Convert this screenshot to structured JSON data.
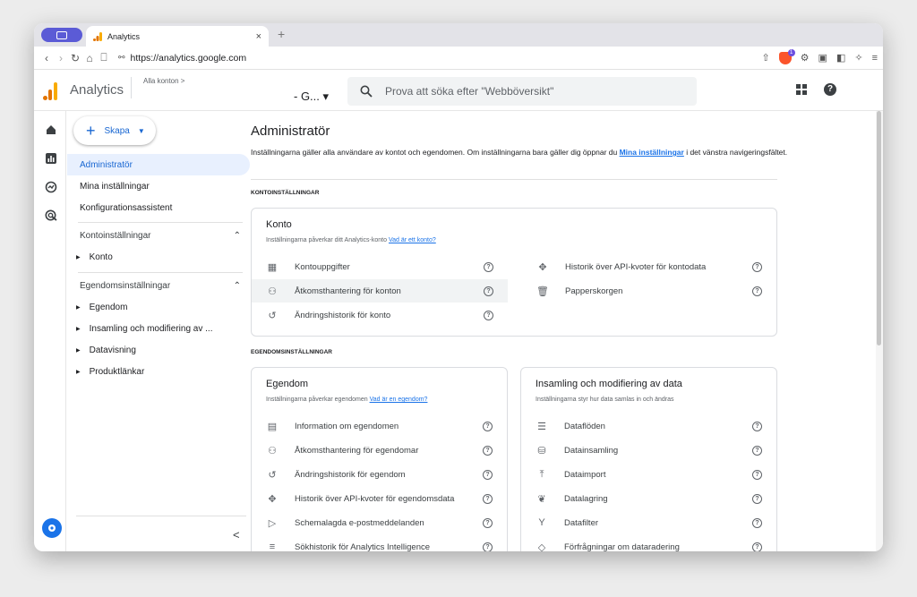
{
  "browser": {
    "tab_title": "Analytics",
    "tab_close": "×",
    "new_tab": "+",
    "url": "https://analytics.google.com"
  },
  "header": {
    "app_name": "Analytics",
    "account_label": "Alla konton >",
    "property_selector": "- G... ▾",
    "search_placeholder": "Prova att söka efter \"Webböversikt\"",
    "help_glyph": "?"
  },
  "nav": {
    "create_label": "Skapa",
    "items": [
      {
        "label": "Administratör",
        "active": true
      },
      {
        "label": "Mina inställningar",
        "active": false
      },
      {
        "label": "Konfigurationsassistent",
        "active": false
      }
    ],
    "account_section": {
      "label": "Kontoinställningar",
      "children": [
        "Konto"
      ]
    },
    "property_section": {
      "label": "Egendomsinställningar",
      "children": [
        "Egendom",
        "Insamling och modifiering av ...",
        "Datavisning",
        "Produktlänkar"
      ]
    },
    "collapse_glyph": "<"
  },
  "main": {
    "title": "Administratör",
    "desc_before": "Inställningarna gäller alla användare av kontot och egendomen. Om inställningarna bara gäller dig öppnar du ",
    "desc_link": "Mina inställningar",
    "desc_after": " i det vänstra navigeringsfältet.",
    "account_section_head": "KONTOINSTÄLLNINGAR",
    "property_section_head": "EGENDOMSINSTÄLLNINGAR",
    "account_card": {
      "title": "Konto",
      "sub": "Inställningarna påverkar ditt Analytics-konto ",
      "sub_link": "Vad är ett konto?",
      "left_rows": [
        {
          "label": "Kontouppgifter",
          "icon": "building-icon"
        },
        {
          "label": "Åtkomsthantering för konton",
          "icon": "people-icon"
        },
        {
          "label": "Ändringshistorik för konto",
          "icon": "history-icon"
        }
      ],
      "right_rows": [
        {
          "label": "Historik över API-kvoter för kontodata",
          "icon": "api-icon"
        },
        {
          "label": "Papperskorgen",
          "icon": "trash-icon"
        }
      ]
    },
    "property_card": {
      "title": "Egendom",
      "sub": "Inställningarna påverkar egendomen ",
      "sub_link": "Vad är en egendom?",
      "rows": [
        {
          "label": "Information om egendomen",
          "icon": "info-card-icon"
        },
        {
          "label": "Åtkomsthantering för egendomar",
          "icon": "people-icon"
        },
        {
          "label": "Ändringshistorik för egendom",
          "icon": "history-icon"
        },
        {
          "label": "Historik över API-kvoter för egendomsdata",
          "icon": "api-icon"
        },
        {
          "label": "Schemalagda e-postmeddelanden",
          "icon": "scheduled-email-icon"
        },
        {
          "label": "Sökhistorik för Analytics Intelligence",
          "icon": "search-history-icon"
        }
      ]
    },
    "collection_card": {
      "title": "Insamling och modifiering av data",
      "sub": "Inställningarna styr hur data samlas in och ändras",
      "rows": [
        {
          "label": "Dataflöden",
          "icon": "data-streams-icon"
        },
        {
          "label": "Datainsamling",
          "icon": "database-icon"
        },
        {
          "label": "Dataimport",
          "icon": "upload-icon"
        },
        {
          "label": "Datalagring",
          "icon": "retention-icon"
        },
        {
          "label": "Datafilter",
          "icon": "filter-icon"
        },
        {
          "label": "Förfrågningar om dataradering",
          "icon": "eraser-icon"
        }
      ]
    }
  },
  "colors": {
    "accent": "#1a73e8",
    "active_bg": "#e8f0fe",
    "ga_orange": "#f9ab00",
    "ga_dark_orange": "#e37400"
  }
}
